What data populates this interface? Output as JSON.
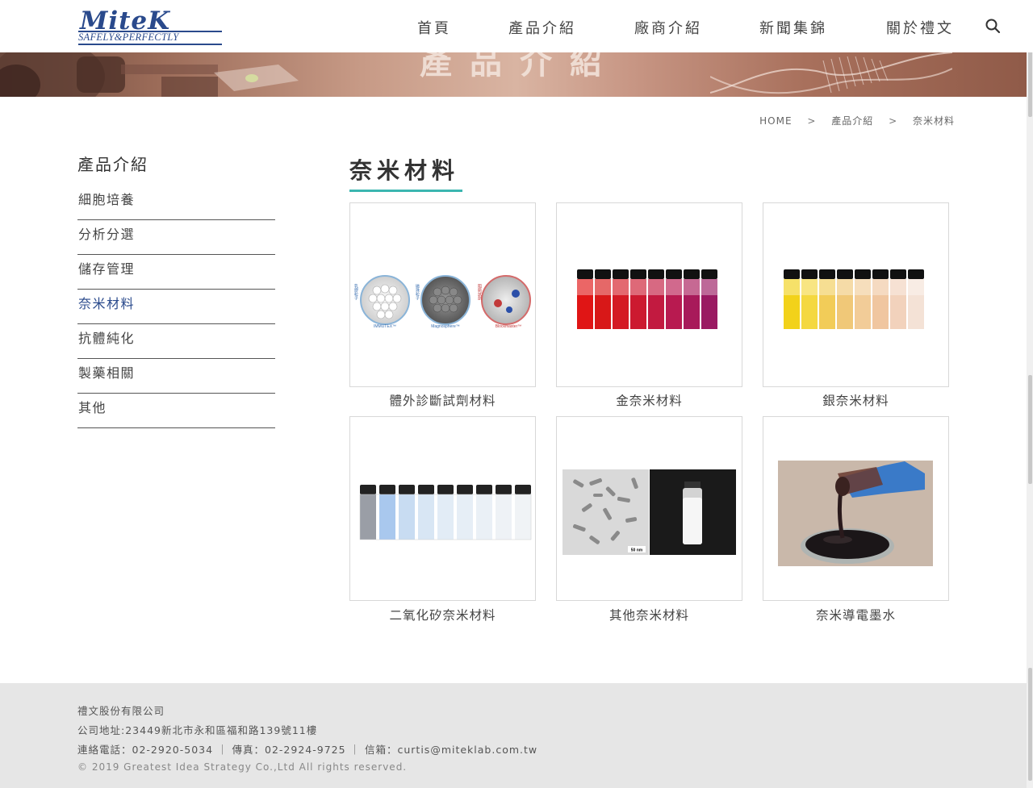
{
  "logo": {
    "main": "MiteK",
    "tagline": "SAFELY&PERFECTLY"
  },
  "nav": {
    "items": [
      {
        "label": "首頁"
      },
      {
        "label": "產品介紹"
      },
      {
        "label": "廠商介紹"
      },
      {
        "label": "新聞集錦"
      },
      {
        "label": "關於禮文"
      }
    ],
    "search_icon": "search-icon"
  },
  "banner": {
    "title": "產品介紹"
  },
  "breadcrumb": {
    "home": "HOME",
    "level1": "產品介紹",
    "level2": "奈米材料",
    "separator": ">"
  },
  "sidebar": {
    "title": "產品介紹",
    "items": [
      {
        "label": "細胞培養",
        "active": false
      },
      {
        "label": "分析分選",
        "active": false
      },
      {
        "label": "儲存管理",
        "active": false
      },
      {
        "label": "奈米材料",
        "active": true
      },
      {
        "label": "抗體純化",
        "active": false
      },
      {
        "label": "製藥相關",
        "active": false
      },
      {
        "label": "其他",
        "active": false
      }
    ]
  },
  "main": {
    "title": "奈米材料",
    "products": [
      {
        "label": "體外診斷試劑材料",
        "image_texts": [
          "IMMUTEX™",
          "Magnosphere™",
          "Blockmaster™"
        ],
        "vertical_labels": [
          "乳膠粒子",
          "磁珠粒子",
          "阻斷試劑"
        ]
      },
      {
        "label": "金奈米材料"
      },
      {
        "label": "銀奈米材料"
      },
      {
        "label": "二氧化矽奈米材料"
      },
      {
        "label": "其他奈米材料",
        "scale_text": "50 nm"
      },
      {
        "label": "奈米導電墨水"
      }
    ]
  },
  "footer": {
    "company": "禮文股份有限公司",
    "address": "公司地址:23449新北市永和區福和路139號11樓",
    "contact": "連絡電話：02-2920-5034 ｜ 傳真：02-2924-9725 ｜ 信箱：curtis@miteklab.com.tw",
    "copyright": "© 2019 Greatest Idea Strategy Co.,Ltd All rights reserved."
  },
  "colors": {
    "brand": "#2a4a8c",
    "accent": "#3bb6b0",
    "footer_bg": "#e6e6e6"
  }
}
